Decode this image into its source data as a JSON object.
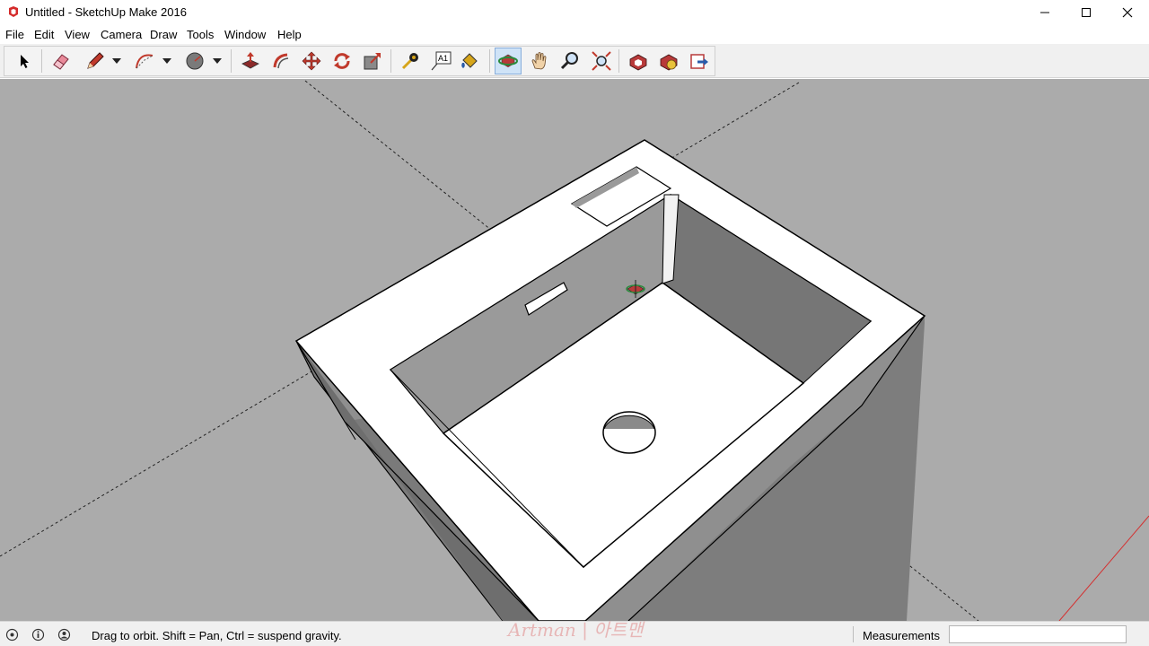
{
  "window": {
    "title": "Untitled - SketchUp Make 2016",
    "minimize_icon": "minimize-icon",
    "maximize_icon": "maximize-icon",
    "close_icon": "close-icon"
  },
  "menu": {
    "items": [
      {
        "label": "File"
      },
      {
        "label": "Edit"
      },
      {
        "label": "View"
      },
      {
        "label": "Camera"
      },
      {
        "label": "Draw"
      },
      {
        "label": "Tools"
      },
      {
        "label": "Window"
      },
      {
        "label": "Help"
      }
    ]
  },
  "toolbar": {
    "tools": [
      {
        "name": "select-tool",
        "icon": "arrow-cursor-icon"
      },
      {
        "name": "eraser-tool",
        "icon": "eraser-icon"
      },
      {
        "name": "line-tool",
        "icon": "pencil-icon"
      },
      {
        "name": "arc-tool",
        "icon": "arc-icon"
      },
      {
        "name": "shapes-tool",
        "icon": "circle-shape-icon"
      },
      {
        "name": "push-pull-tool",
        "icon": "push-pull-icon"
      },
      {
        "name": "follow-me-tool",
        "icon": "follow-me-icon"
      },
      {
        "name": "move-tool",
        "icon": "move-arrows-icon"
      },
      {
        "name": "rotate-tool",
        "icon": "rotate-icon"
      },
      {
        "name": "scale-tool",
        "icon": "scale-icon"
      },
      {
        "name": "tape-measure-tool",
        "icon": "tape-measure-icon"
      },
      {
        "name": "text-tool",
        "icon": "text-label-icon"
      },
      {
        "name": "paint-bucket-tool",
        "icon": "paint-bucket-icon"
      },
      {
        "name": "orbit-tool",
        "icon": "orbit-icon",
        "active": true
      },
      {
        "name": "pan-tool",
        "icon": "hand-icon"
      },
      {
        "name": "zoom-tool",
        "icon": "magnifier-icon"
      },
      {
        "name": "zoom-extents-tool",
        "icon": "zoom-extents-icon"
      },
      {
        "name": "warehouse-tool",
        "icon": "3d-warehouse-icon"
      },
      {
        "name": "extension-warehouse-tool",
        "icon": "extension-warehouse-icon"
      },
      {
        "name": "share-model-tool",
        "icon": "share-model-icon"
      }
    ],
    "text_tool_glyph": "A1"
  },
  "status": {
    "hint": "Drag to orbit. Shift = Pan, Ctrl = suspend gravity.",
    "icons": [
      "geo-location-icon",
      "credits-icon",
      "user-icon"
    ],
    "measurements_label": "Measurements",
    "measurements_value": ""
  },
  "overlay": {
    "watermark": "Artman | 아트맨"
  },
  "colors": {
    "viewport": "#ababab",
    "model_face": "#ffffff",
    "model_shadow": "#7a7a7a",
    "model_mid": "#9a9a9a",
    "axis_red": "#d43030",
    "active_tool": "#cfe3f7"
  }
}
